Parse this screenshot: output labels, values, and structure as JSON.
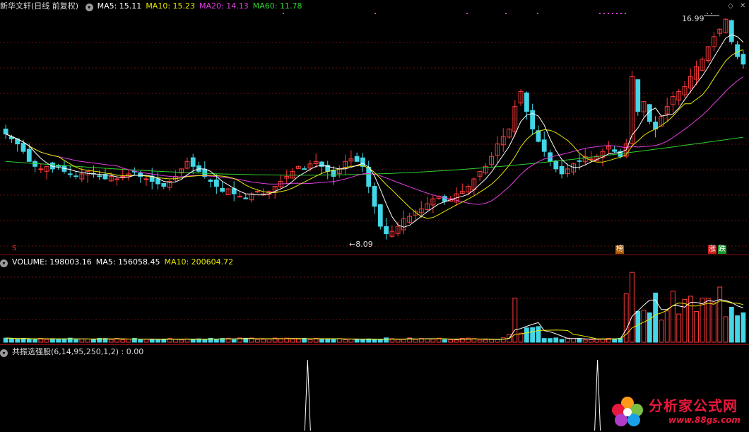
{
  "price_panel": {
    "stock_name": "新华文轩",
    "period": "(日线 前复权)",
    "ma_labels": [
      {
        "text": "MA5: 15.11",
        "color": "#ffffff"
      },
      {
        "text": "MA10: 15.23",
        "color": "#e8e800"
      },
      {
        "text": "MA20: 14.13",
        "color": "#e040e0"
      },
      {
        "text": "MA60: 11.78",
        "color": "#30d030"
      }
    ],
    "high_label": "16.99",
    "low_label": "8.09",
    "marker_s": "S",
    "marker_bang": "榜",
    "marker_zhang": "涨",
    "marker_die": "跌"
  },
  "volume_panel": {
    "labels": [
      {
        "text": "VOLUME: 198003.16",
        "color": "#ffffff"
      },
      {
        "text": "MA5: 156058.45",
        "color": "#ffffff"
      },
      {
        "text": "MA10: 200604.72",
        "color": "#e8e800"
      }
    ]
  },
  "indicator_panel": {
    "label": "共振选强股(6,14,95,250,1,2) : 0.00"
  },
  "watermark": {
    "name": "分析家公式网",
    "url": "www.88gs.com"
  },
  "chart_data": {
    "type": "candlestick",
    "y_range": [
      8.09,
      16.99
    ],
    "candles_close_approx": [
      12.3,
      12.1,
      11.9,
      11.6,
      11.2,
      11.0,
      10.9,
      11.0,
      10.9,
      11.0,
      10.8,
      10.7,
      10.6,
      10.7,
      10.8,
      10.7,
      10.6,
      10.5,
      10.6,
      10.5,
      10.6,
      10.7,
      10.8,
      10.6,
      10.5,
      10.4,
      10.3,
      10.2,
      10.4,
      10.6,
      10.9,
      11.2,
      11.0,
      10.8,
      10.6,
      10.4,
      10.2,
      10.0,
      10.1,
      9.9,
      9.8,
      9.7,
      9.9,
      10.0,
      9.9,
      10.0,
      10.2,
      10.4,
      10.6,
      10.8,
      11.0,
      10.9,
      11.1,
      11.2,
      11.0,
      10.8,
      10.6,
      10.9,
      11.2,
      11.3,
      11.2,
      11.0,
      10.2,
      9.4,
      8.6,
      8.3,
      8.4,
      8.6,
      8.9,
      9.0,
      9.2,
      9.3,
      9.5,
      9.7,
      9.8,
      9.6,
      9.7,
      9.9,
      10.0,
      10.2,
      10.5,
      10.8,
      11.0,
      11.4,
      11.9,
      12.2,
      12.5,
      13.4,
      14.0,
      13.2,
      12.5,
      12.0,
      11.6,
      11.2,
      10.9,
      10.7,
      10.9,
      11.1,
      11.2,
      11.4,
      11.3,
      11.4,
      11.6,
      11.8,
      11.6,
      11.4,
      11.9,
      14.6,
      13.2,
      13.6,
      12.8,
      12.5,
      13.0,
      13.4,
      13.8,
      14.0,
      14.2,
      14.6,
      15.0,
      15.3,
      15.8,
      16.2,
      16.5,
      16.9,
      16.0,
      15.4,
      15.1
    ],
    "volume_range": [
      0,
      600000
    ],
    "volume": {
      "last": 198003.16,
      "ma5": 156058.45,
      "ma10": 200604.72
    },
    "ma": {
      "ma5": 15.11,
      "ma10": 15.23,
      "ma20": 14.13,
      "ma60": 11.78
    },
    "indicator_signals_x_fraction": [
      0.41,
      0.8
    ]
  }
}
